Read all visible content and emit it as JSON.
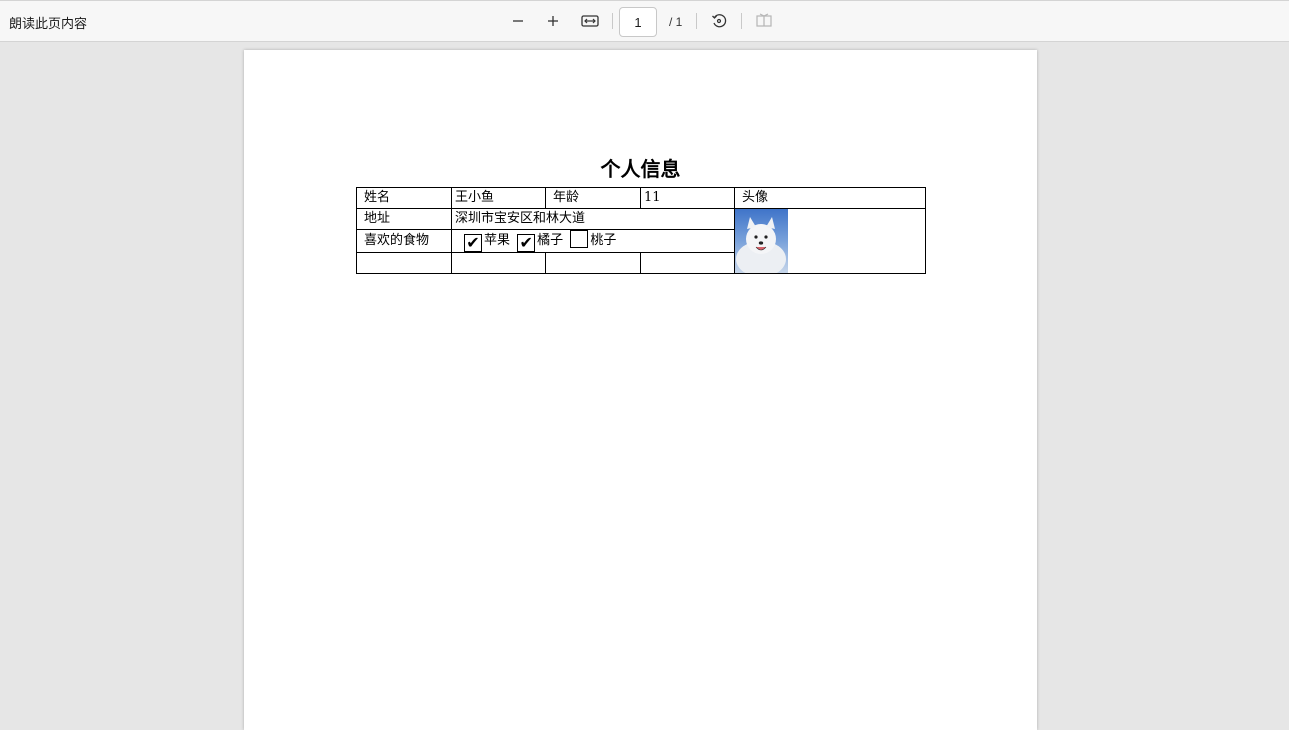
{
  "toolbar": {
    "read_aloud": "朗读此页内容",
    "current_page": "1",
    "total_pages": "/ 1"
  },
  "document": {
    "title": "个人信息",
    "labels": {
      "name": "姓名",
      "age": "年龄",
      "avatar": "头像",
      "address": "地址",
      "favorite_foods": "喜欢的食物"
    },
    "values": {
      "name": "王小鱼",
      "age": "11",
      "address": "深圳市宝安区和林大道"
    },
    "foods": [
      {
        "label": "苹果",
        "checked": true,
        "mark": "✔"
      },
      {
        "label": "橘子",
        "checked": true,
        "mark": "✔"
      },
      {
        "label": "桃子",
        "checked": false,
        "mark": ""
      }
    ]
  }
}
